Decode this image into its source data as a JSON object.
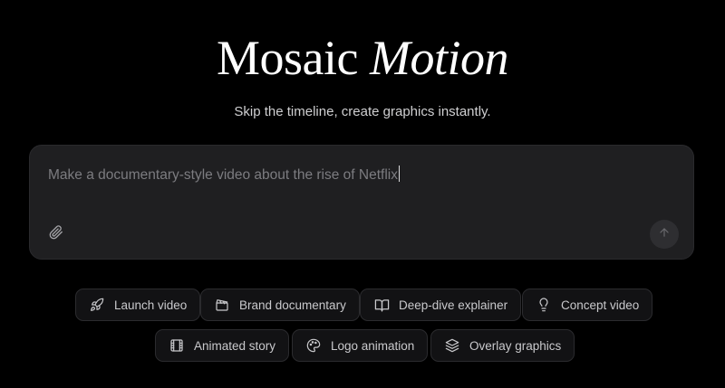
{
  "header": {
    "title_plain": "Mosaic",
    "title_italic": "Motion",
    "subtitle": "Skip the timeline, create graphics instantly."
  },
  "prompt": {
    "value": "Make a documentary-style video about the rise of Netflix"
  },
  "chips": [
    {
      "label": "Launch video",
      "icon": "rocket-icon"
    },
    {
      "label": "Brand documentary",
      "icon": "clapperboard-icon"
    },
    {
      "label": "Deep-dive explainer",
      "icon": "book-open-icon"
    },
    {
      "label": "Concept video",
      "icon": "lightbulb-icon"
    },
    {
      "label": "Animated story",
      "icon": "film-icon"
    },
    {
      "label": "Logo animation",
      "icon": "palette-icon"
    },
    {
      "label": "Overlay graphics",
      "icon": "layers-icon"
    }
  ],
  "colors": {
    "background": "#000000",
    "box": "#1f1f21",
    "chip_border": "#2b2b2e",
    "placeholder_text": "#7c7c80"
  }
}
